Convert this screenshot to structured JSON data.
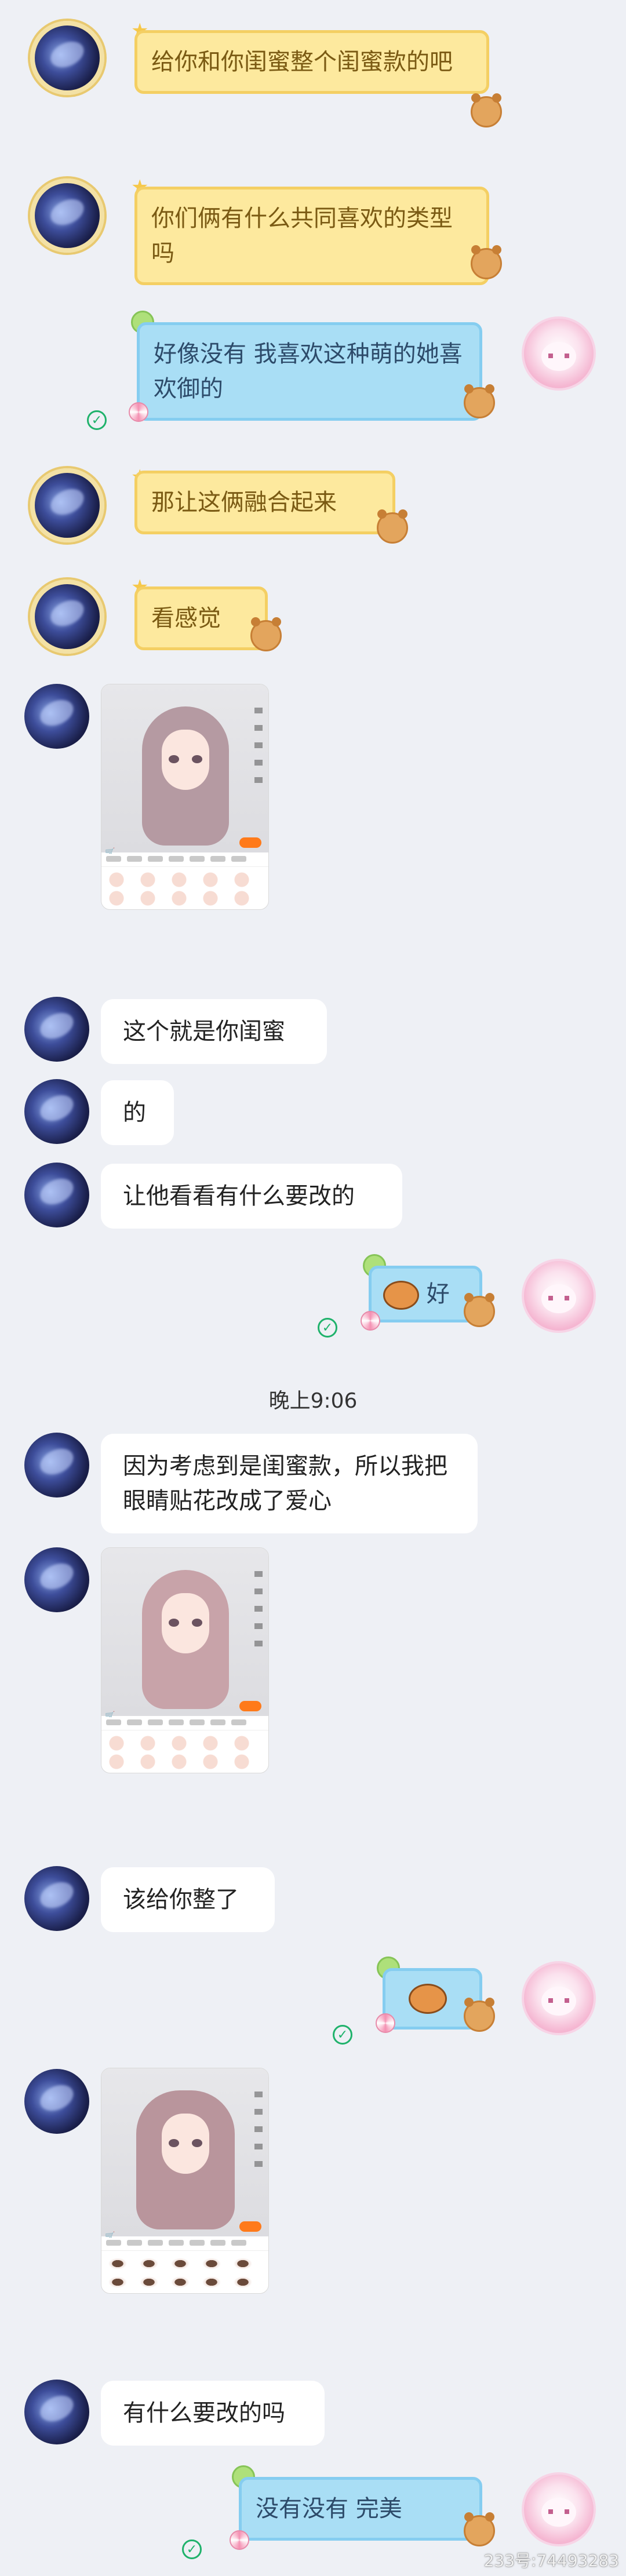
{
  "messages": [
    {
      "text": "给你和你闺蜜整个闺蜜款的吧"
    },
    {
      "text": "你们俩有什么共同喜欢的类型吗"
    },
    {
      "text": "好像没有 我喜欢这种萌的她喜欢御的"
    },
    {
      "text": "那让这俩融合起来"
    },
    {
      "text": "看感觉"
    },
    {
      "text": "这个就是你闺蜜"
    },
    {
      "text": "的"
    },
    {
      "text": "让他看看有什么要改的"
    },
    {
      "text": "好"
    },
    {
      "text": "因为考虑到是闺蜜款，所以我把眼睛贴花改成了爱心"
    },
    {
      "text": "该给你整了"
    },
    {
      "text": "有什么要改的吗"
    },
    {
      "text": "没有没有 完美"
    }
  ],
  "time_separator": "晚上9:06",
  "watermark": "233号:74493283",
  "icons": {
    "read": "read-check-icon",
    "sticker": "tiger-sticker-icon",
    "cart": "cart-icon"
  },
  "colors": {
    "yellow_bubble": "#fde99e",
    "blue_bubble": "#a9def5",
    "read_check": "#1fb26b"
  }
}
